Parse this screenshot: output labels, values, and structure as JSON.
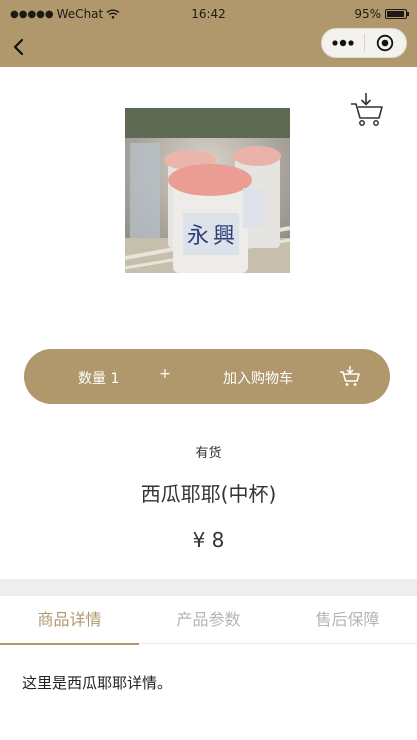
{
  "status_bar": {
    "carrier": "WeChat",
    "time": "16:42",
    "battery": "95%",
    "battery_level": 0.95
  },
  "nav": {
    "back_icon": "chevron-left-icon",
    "more_icon": "more-dots-icon",
    "close_icon": "target-close-icon"
  },
  "cart_icon": "cart-download-icon",
  "product": {
    "image_alt": "西瓜耶耶(中杯)",
    "stock": "有货",
    "name": "西瓜耶耶(中杯)",
    "price": "¥ 8"
  },
  "action_bar": {
    "quantity_label": "数量 1",
    "plus_label": "+",
    "add_to_cart_label": "加入购物车",
    "cart_icon": "cart-icon"
  },
  "tabs": [
    {
      "label": "商品详情",
      "active": true
    },
    {
      "label": "产品参数",
      "active": false
    },
    {
      "label": "售后保障",
      "active": false
    }
  ],
  "detail": {
    "text": "这里是西瓜耶耶详情。"
  },
  "colors": {
    "accent": "#b0976c",
    "tab_inactive": "#b5b5b5",
    "band": "#eeeeee"
  }
}
